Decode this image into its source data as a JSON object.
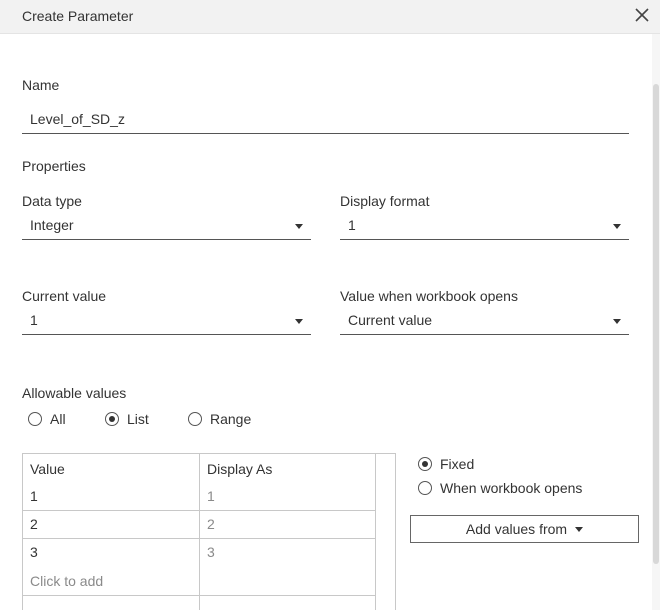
{
  "dialog": {
    "title": "Create Parameter"
  },
  "name": {
    "label": "Name",
    "value": "Level_of_SD_z"
  },
  "properties": {
    "heading": "Properties",
    "data_type": {
      "label": "Data type",
      "value": "Integer"
    },
    "display_format": {
      "label": "Display format",
      "value": "1"
    },
    "current_value": {
      "label": "Current value",
      "value": "1"
    },
    "value_when_opens": {
      "label": "Value when workbook opens",
      "value": "Current value"
    }
  },
  "allowable": {
    "label": "Allowable values",
    "options": [
      {
        "label": "All",
        "checked": false
      },
      {
        "label": "List",
        "checked": true
      },
      {
        "label": "Range",
        "checked": false
      }
    ]
  },
  "list_table": {
    "headers": [
      "Value",
      "Display As"
    ],
    "rows": [
      {
        "value": "1",
        "display": "1"
      },
      {
        "value": "2",
        "display": "2"
      },
      {
        "value": "3",
        "display": "3"
      }
    ],
    "add_placeholder": "Click to add"
  },
  "list_source": {
    "options": [
      {
        "label": "Fixed",
        "checked": true
      },
      {
        "label": "When workbook opens",
        "checked": false
      }
    ],
    "add_values_button": "Add values from"
  }
}
